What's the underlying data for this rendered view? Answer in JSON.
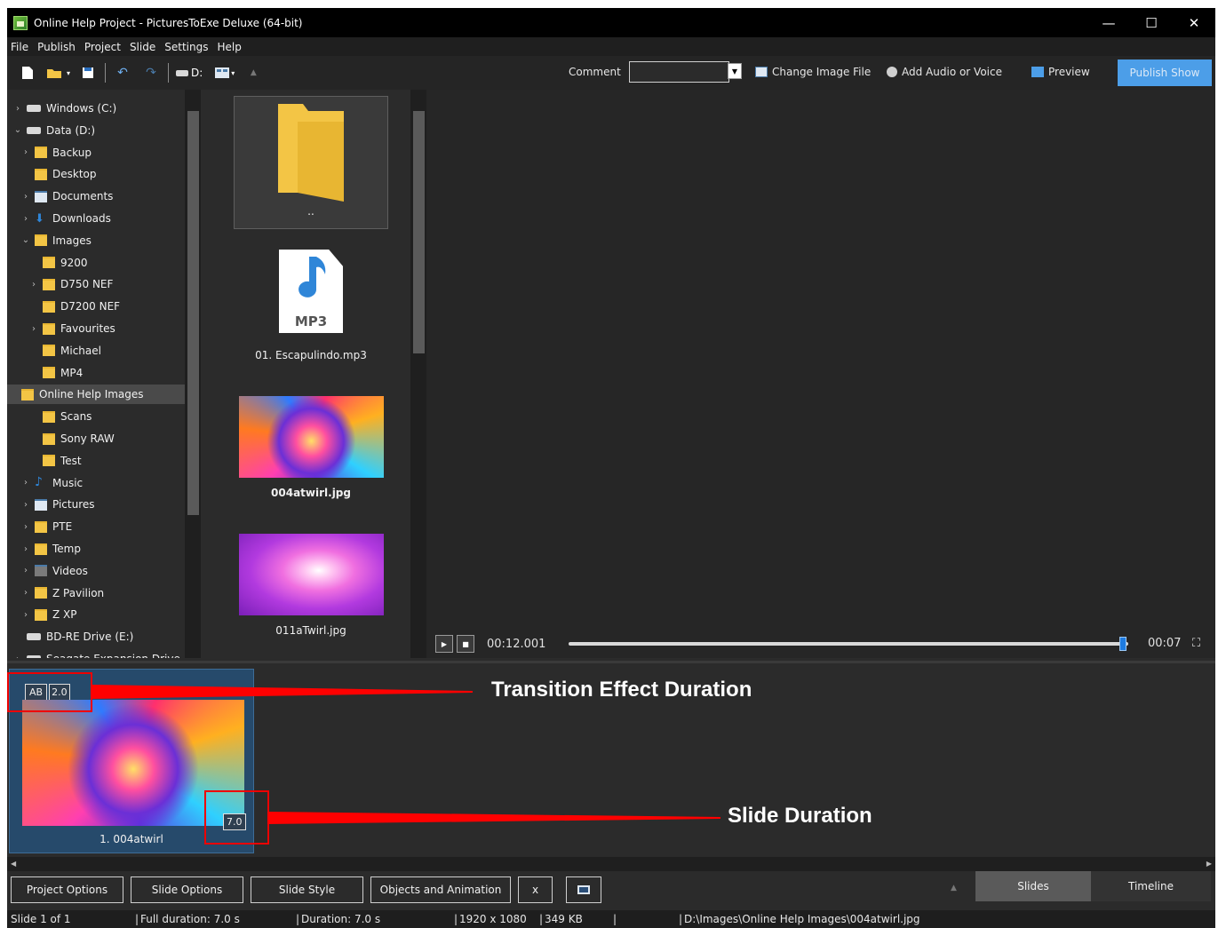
{
  "window": {
    "title": "Online Help Project - PicturesToExe Deluxe (64-bit)",
    "controls": {
      "minimize": "—",
      "maximize": "☐",
      "close": "✕"
    }
  },
  "menu": [
    "File",
    "Publish",
    "Project",
    "Slide",
    "Settings",
    "Help"
  ],
  "toolbar": {
    "drive_label": "D:",
    "comment_label": "Comment",
    "comment_value": "",
    "change_image_label": "Change Image File",
    "add_audio_label": "Add Audio or Voice",
    "preview_label": "Preview",
    "publish_label": "Publish Show"
  },
  "tree": [
    {
      "label": "Windows (C:)",
      "icon": "drive-icon",
      "chev": "›",
      "depth": 0
    },
    {
      "label": "Data (D:)",
      "icon": "drive-icon",
      "chev": "⌄",
      "depth": 0
    },
    {
      "label": "Backup",
      "icon": "folder-icon",
      "chev": "›",
      "depth": 1
    },
    {
      "label": "Desktop",
      "icon": "folder-icon",
      "chev": "",
      "depth": 1
    },
    {
      "label": "Documents",
      "icon": "documents-icon",
      "chev": "›",
      "depth": 1
    },
    {
      "label": "Downloads",
      "icon": "download-icon",
      "chev": "›",
      "depth": 1
    },
    {
      "label": "Images",
      "icon": "folder-icon",
      "chev": "⌄",
      "depth": 1
    },
    {
      "label": "9200",
      "icon": "folder-icon",
      "chev": "",
      "depth": 2
    },
    {
      "label": "D750 NEF",
      "icon": "folder-icon",
      "chev": "›",
      "depth": 2
    },
    {
      "label": "D7200 NEF",
      "icon": "folder-icon",
      "chev": "",
      "depth": 2
    },
    {
      "label": "Favourites",
      "icon": "folder-icon",
      "chev": "›",
      "depth": 2
    },
    {
      "label": "Michael",
      "icon": "folder-icon",
      "chev": "",
      "depth": 2
    },
    {
      "label": "MP4",
      "icon": "folder-icon",
      "chev": "",
      "depth": 2
    },
    {
      "label": "Online Help Images",
      "icon": "folder-icon",
      "chev": "",
      "depth": 2,
      "selected": true
    },
    {
      "label": "Scans",
      "icon": "folder-icon",
      "chev": "",
      "depth": 2
    },
    {
      "label": "Sony RAW",
      "icon": "folder-icon",
      "chev": "",
      "depth": 2
    },
    {
      "label": "Test",
      "icon": "folder-icon",
      "chev": "",
      "depth": 2
    },
    {
      "label": "Music",
      "icon": "music-icon",
      "chev": "›",
      "depth": 1
    },
    {
      "label": "Pictures",
      "icon": "pictures-icon",
      "chev": "›",
      "depth": 1
    },
    {
      "label": "PTE",
      "icon": "folder-icon",
      "chev": "›",
      "depth": 1
    },
    {
      "label": "Temp",
      "icon": "folder-icon",
      "chev": "›",
      "depth": 1
    },
    {
      "label": "Videos",
      "icon": "videos-icon",
      "chev": "›",
      "depth": 1
    },
    {
      "label": "Z Pavilion",
      "icon": "folder-icon",
      "chev": "›",
      "depth": 1
    },
    {
      "label": "Z XP",
      "icon": "folder-icon",
      "chev": "›",
      "depth": 1
    },
    {
      "label": "BD-RE Drive (E:)",
      "icon": "disc-drive-icon",
      "chev": "",
      "depth": 0
    },
    {
      "label": "Seagate Expansion Drive",
      "icon": "drive-icon",
      "chev": "›",
      "depth": 0
    }
  ],
  "files": {
    "up_label": "..",
    "mp3_badge": "MP3",
    "mp3_label": "01. Escapulindo.mp3",
    "img1_label": "004atwirl.jpg",
    "img2_label": "011aTwirl.jpg"
  },
  "player": {
    "current_time": "00:12.001",
    "duration": "00:07",
    "progress": 0.99
  },
  "slide": {
    "label": "1. 004atwirl",
    "transition_ab": "AB",
    "transition_duration": "2.0",
    "slide_duration": "7.0"
  },
  "annotations": {
    "transition": "Transition Effect Duration",
    "slide": "Slide Duration"
  },
  "buttons": {
    "project_options": "Project Options",
    "slide_options": "Slide Options",
    "slide_style": "Slide Style",
    "objects_animation": "Objects and Animation",
    "x": "x"
  },
  "tabs": {
    "slides": "Slides",
    "timeline": "Timeline"
  },
  "status": {
    "slide_of": "Slide 1 of 1",
    "full_duration": "Full duration: 7.0 s",
    "duration": "Duration: 7.0 s",
    "resolution": "1920 x 1080",
    "size": "349 KB",
    "path": "D:\\Images\\Online Help Images\\004atwirl.jpg"
  },
  "colors": {
    "accent": "#4c9ee8",
    "annotation": "#ff0000",
    "selection": "#264a6b"
  }
}
